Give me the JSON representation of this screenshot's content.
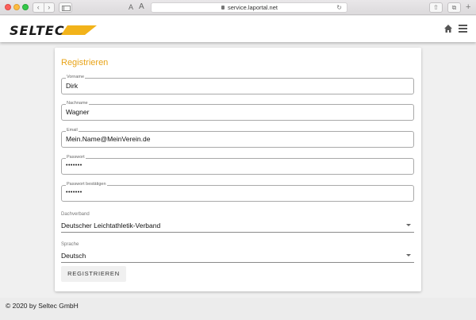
{
  "browser": {
    "url": "service.laportal.net",
    "back_icon": "‹",
    "forward_icon": "›",
    "font_small": "A",
    "font_large": "A",
    "reload_icon": "↻",
    "share_icon": "⇧",
    "tabs_icon": "⧉",
    "new_tab_icon": "+"
  },
  "header": {
    "logo_text": "SELTEC",
    "logo_color": "#f2b31a"
  },
  "form": {
    "title": "Registrieren",
    "accent_color": "#e8a317",
    "fields": {
      "vorname": {
        "label": "Vorname",
        "value": "Dirk"
      },
      "nachname": {
        "label": "Nachname",
        "value": "Wagner"
      },
      "email": {
        "label": "Email",
        "value": "Mein.Name@MeinVerein.de"
      },
      "passwort": {
        "label": "Passwort",
        "value": "•••••••"
      },
      "passwort_bestaetigen": {
        "label": "Passwort bestätigen",
        "value": "•••••••"
      }
    },
    "dachverband": {
      "label": "Dachverband",
      "value": "Deutscher Leichtathletik-Verband"
    },
    "sprache": {
      "label": "Sprache",
      "value": "Deutsch"
    },
    "submit_label": "REGISTRIEREN"
  },
  "footer": {
    "text": "© 2020 by Seltec GmbH"
  }
}
